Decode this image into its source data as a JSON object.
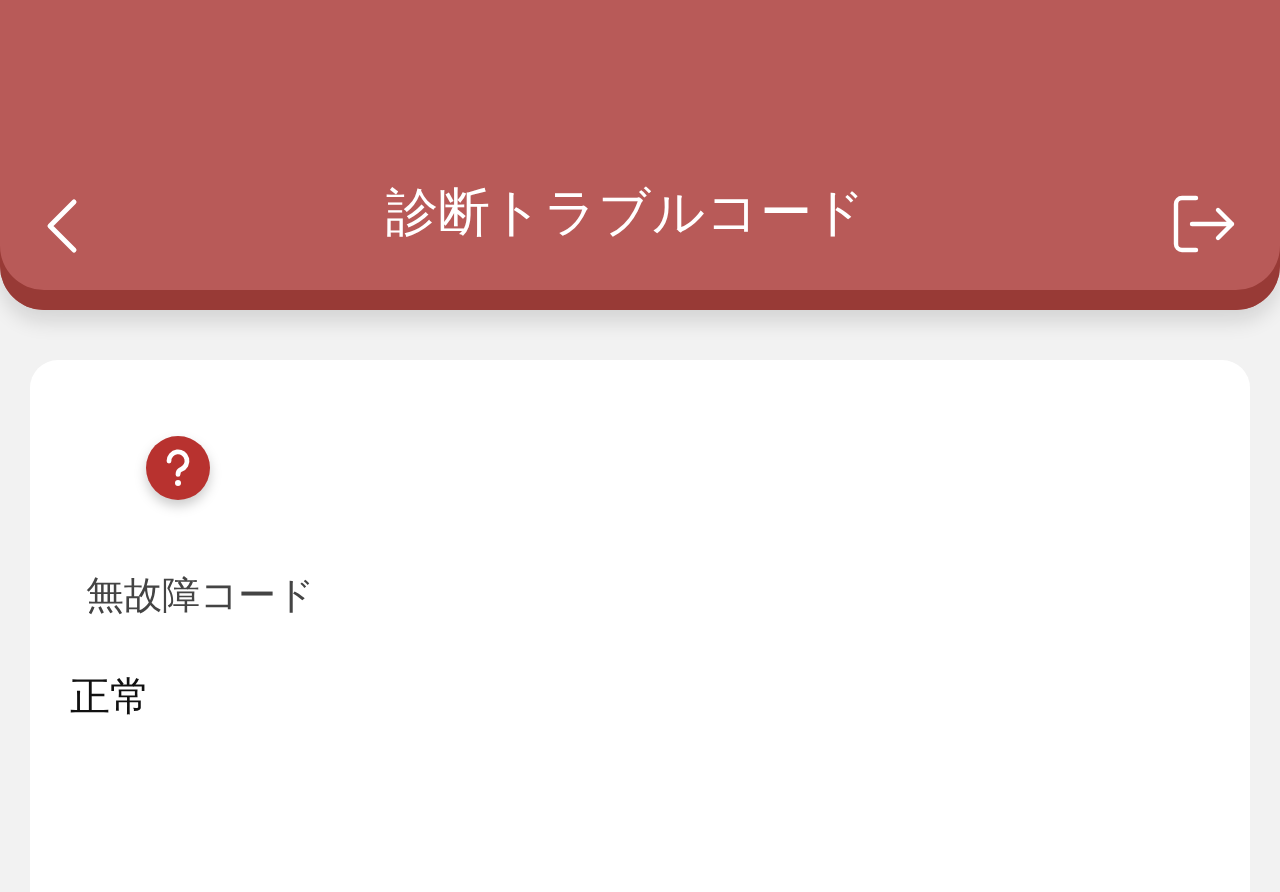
{
  "header": {
    "title": "診断トラブルコード"
  },
  "card": {
    "status_label": "無故障コード",
    "status_value": "正常"
  }
}
